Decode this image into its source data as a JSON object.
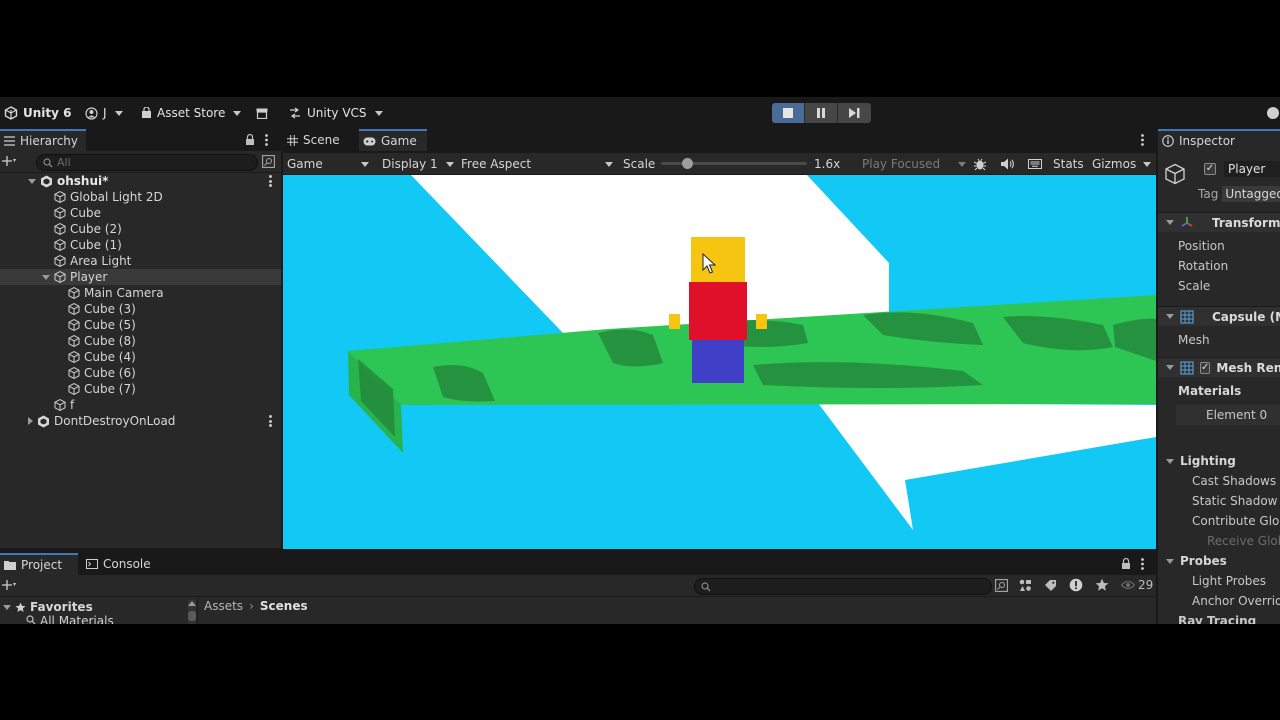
{
  "toolbar": {
    "app_name": "Unity 6",
    "account": "J",
    "asset_store": "Asset Store",
    "vcs": "Unity VCS"
  },
  "hierarchy": {
    "tab_label": "Hierarchy",
    "search_placeholder": "All",
    "scene_name": "ohshui*",
    "items": [
      "Global Light 2D",
      "Cube",
      "Cube (2)",
      "Cube (1)",
      "Area Light",
      "Player",
      "Main Camera",
      "Cube (3)",
      "Cube (5)",
      "Cube (8)",
      "Cube (4)",
      "Cube (6)",
      "Cube (7)",
      "f"
    ],
    "dont_destroy": "DontDestroyOnLoad"
  },
  "game_view": {
    "tabs": [
      "Scene",
      "Game"
    ],
    "mode": "Game",
    "display": "Display 1",
    "aspect": "Free Aspect",
    "scale_label": "Scale",
    "scale_value": "1.6x",
    "scale_fraction": 0.18,
    "play_mode": "Play Focused",
    "stats": "Stats",
    "gizmos": "Gizmos"
  },
  "inspector": {
    "tab_label": "Inspector",
    "object_name": "Player",
    "tag_label": "Tag",
    "tag_value": "Untagged",
    "transform": "Transform",
    "position": "Position",
    "rotation": "Rotation",
    "scale": "Scale",
    "capsule": "Capsule (M",
    "mesh": "Mesh",
    "mesh_renderer": "Mesh Rend",
    "materials": "Materials",
    "element0": "Element 0",
    "lighting": "Lighting",
    "cast_shadows": "Cast Shadows",
    "static_shadow": "Static Shadow C",
    "contribute_gi": "Contribute Glob",
    "receive_gi": "Receive Glob",
    "probes": "Probes",
    "light_probes": "Light Probes",
    "anchor_override": "Anchor Overrid",
    "ray_tracing": "Ray Tracing"
  },
  "bottom": {
    "tabs": [
      "Project",
      "Console"
    ],
    "favorites": "Favorites",
    "all_materials": "All Materials",
    "breadcrumb_root": "Assets",
    "breadcrumb_current": "Scenes",
    "hidden_count": "29"
  },
  "colors": {
    "sky": "#12c9f6",
    "platform": "#2dc553",
    "platform_dark": "#248a3c",
    "head": "#f6c511",
    "torso": "#e0102a",
    "legs": "#3f3fc8",
    "accent": "#3a79bb"
  }
}
